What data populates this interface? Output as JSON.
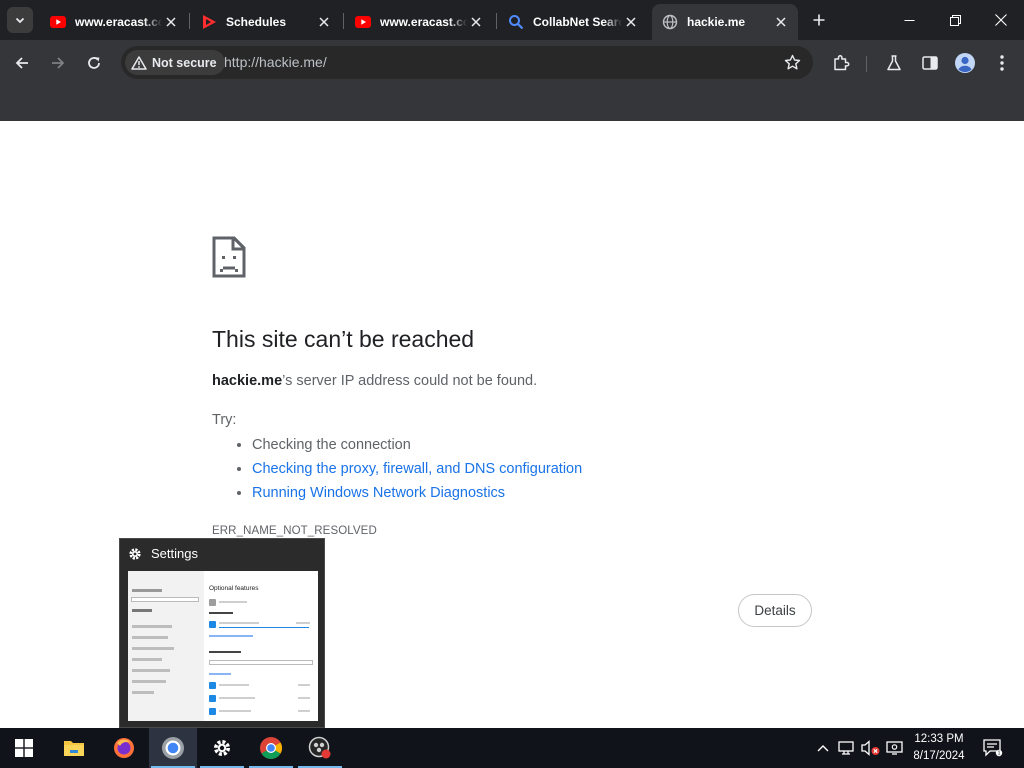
{
  "browser": {
    "tabs": [
      {
        "title": "www.eracast.com",
        "favicon": "youtube-icon",
        "active": false
      },
      {
        "title": "Schedules",
        "favicon": "play-logo-icon",
        "active": false
      },
      {
        "title": "www.eracast.com",
        "favicon": "youtube-icon",
        "active": false
      },
      {
        "title": "CollabNet Search",
        "favicon": "search-icon",
        "active": false
      },
      {
        "title": "hackie.me",
        "favicon": "globe-icon",
        "active": true
      }
    ],
    "security_label": "Not secure",
    "url": "http://hackie.me/",
    "colors": {
      "chrome": "#202124",
      "toolbar": "#35363a",
      "link": "#1a73e8"
    }
  },
  "error_page": {
    "title": "This site can’t be reached",
    "host": "hackie.me",
    "description": "’s server IP address could not be found.",
    "try_label": "Try:",
    "suggestions": [
      "Checking the connection",
      "Checking the proxy, firewall, and DNS configuration",
      "Running Windows Network Diagnostics"
    ],
    "error_code": "ERR_NAME_NOT_RESOLVED",
    "details_label": "Details"
  },
  "settings_thumbnail": {
    "title": "Settings",
    "inner_title": "Optional features"
  },
  "taskbar": {
    "apps": [
      "windows-start-icon",
      "file-explorer-icon",
      "firefox-icon",
      "chrome-canary-icon",
      "settings-gear-icon",
      "chrome-icon",
      "obs-icon"
    ],
    "time": "12:33 PM",
    "date": "8/17/2024"
  }
}
